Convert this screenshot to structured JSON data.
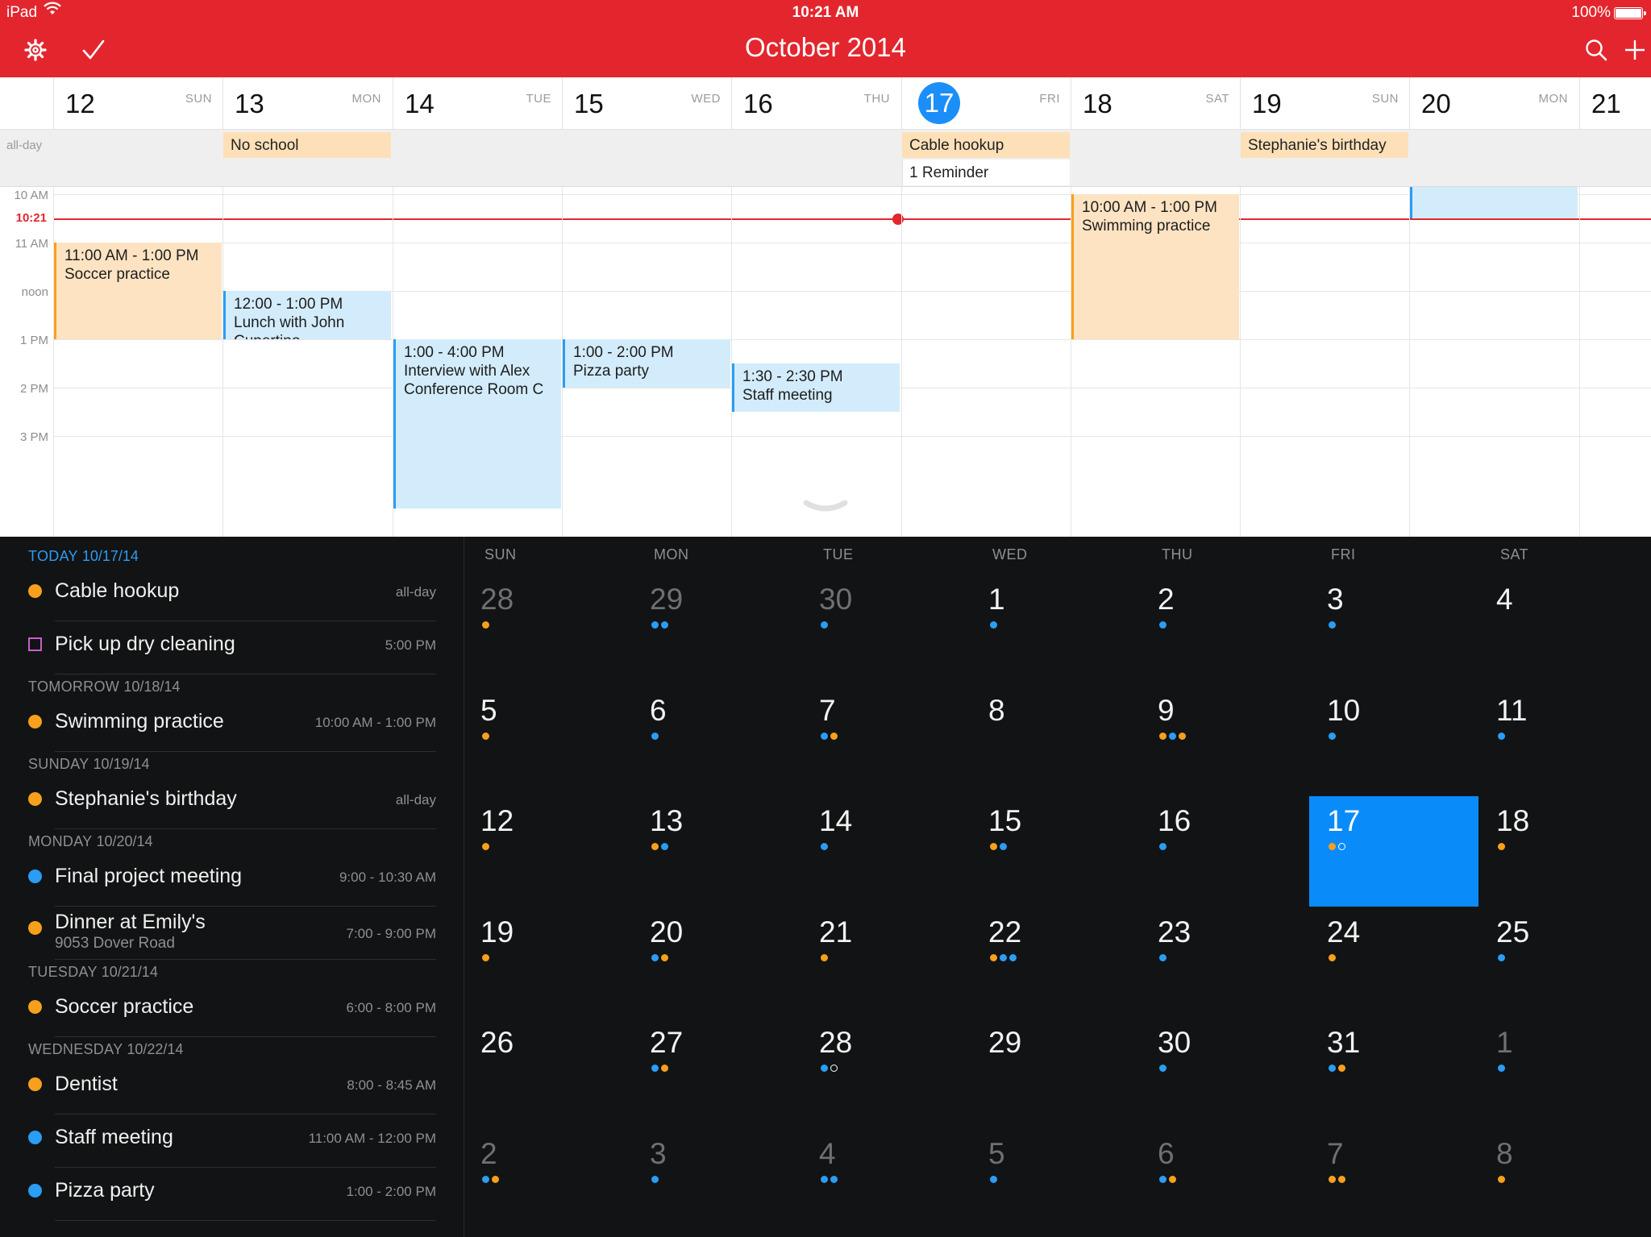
{
  "status": {
    "device": "iPad",
    "time": "10:21 AM",
    "battery": "100%"
  },
  "nav": {
    "title": "October 2014"
  },
  "colors": {
    "accent": "#e3262e",
    "today": "#1b8ef9",
    "orange": "#f7a01b",
    "blue": "#2a9df4"
  },
  "week": {
    "days": [
      {
        "num": "12",
        "wd": "SUN"
      },
      {
        "num": "13",
        "wd": "MON"
      },
      {
        "num": "14",
        "wd": "TUE"
      },
      {
        "num": "15",
        "wd": "WED"
      },
      {
        "num": "16",
        "wd": "THU"
      },
      {
        "num": "17",
        "wd": "FRI",
        "today": true
      },
      {
        "num": "18",
        "wd": "SAT"
      },
      {
        "num": "19",
        "wd": "SUN"
      },
      {
        "num": "20",
        "wd": "MON"
      },
      {
        "num": "21",
        "wd": ""
      }
    ],
    "allday_label": "all-day",
    "allday_events": [
      {
        "day": "13",
        "title": "No school"
      },
      {
        "day": "17",
        "title": "Cable hookup"
      },
      {
        "day": "19",
        "title": "Stephanie's birthday"
      }
    ],
    "reminder": {
      "day": "17",
      "text": "1 Reminder"
    },
    "hours": [
      "10 AM",
      "11 AM",
      "noon",
      "1 PM",
      "2 PM",
      "3 PM"
    ],
    "now_label": "10:21",
    "events": [
      {
        "day": "12",
        "color": "orange",
        "time": "11:00 AM - 1:00 PM",
        "title": "Soccer practice",
        "location": ""
      },
      {
        "day": "13",
        "color": "blue",
        "time": "12:00 - 1:00 PM",
        "title": "Lunch with John",
        "location": "Cupertino"
      },
      {
        "day": "14",
        "color": "blue",
        "time": "1:00 - 4:00 PM",
        "title": "Interview with Alex",
        "location": "Conference Room C"
      },
      {
        "day": "15",
        "color": "blue",
        "time": "1:00 - 2:00 PM",
        "title": "Pizza party",
        "location": ""
      },
      {
        "day": "16",
        "color": "blue",
        "time": "1:30 - 2:30 PM",
        "title": "Staff meeting",
        "location": ""
      },
      {
        "day": "18",
        "color": "orange",
        "time": "10:00 AM - 1:00 PM",
        "title": "Swimming practice",
        "location": ""
      },
      {
        "day": "20",
        "color": "blue",
        "time": "",
        "title": "",
        "location": ""
      }
    ]
  },
  "agenda": {
    "sections": [
      {
        "label": "TODAY",
        "date": "10/17/14",
        "today": true,
        "items": [
          {
            "kind": "dot",
            "color": "orange",
            "title": "Cable hookup",
            "time": "all-day"
          },
          {
            "kind": "box",
            "color": "purple",
            "title": "Pick up dry cleaning",
            "time": "5:00 PM"
          }
        ]
      },
      {
        "label": "TOMORROW",
        "date": "10/18/14",
        "items": [
          {
            "kind": "dot",
            "color": "orange",
            "title": "Swimming practice",
            "time": "10:00 AM - 1:00 PM"
          }
        ]
      },
      {
        "label": "SUNDAY",
        "date": "10/19/14",
        "items": [
          {
            "kind": "dot",
            "color": "orange",
            "title": "Stephanie's birthday",
            "time": "all-day"
          }
        ]
      },
      {
        "label": "MONDAY",
        "date": "10/20/14",
        "items": [
          {
            "kind": "dot",
            "color": "blue",
            "title": "Final project meeting",
            "time": "9:00 - 10:30 AM"
          },
          {
            "kind": "dot",
            "color": "orange",
            "title": "Dinner at Emily's",
            "sub": "9053 Dover Road",
            "time": "7:00 - 9:00 PM"
          }
        ]
      },
      {
        "label": "TUESDAY",
        "date": "10/21/14",
        "items": [
          {
            "kind": "dot",
            "color": "orange",
            "title": "Soccer practice",
            "time": "6:00 - 8:00 PM"
          }
        ]
      },
      {
        "label": "WEDNESDAY",
        "date": "10/22/14",
        "items": [
          {
            "kind": "dot",
            "color": "orange",
            "title": "Dentist",
            "time": "8:00 - 8:45 AM"
          },
          {
            "kind": "dot",
            "color": "blue",
            "title": "Staff meeting",
            "time": "11:00 AM - 12:00 PM"
          },
          {
            "kind": "dot",
            "color": "blue",
            "title": "Pizza party",
            "time": "1:00 - 2:00 PM"
          }
        ]
      }
    ]
  },
  "month": {
    "weekdays": [
      "SUN",
      "MON",
      "TUE",
      "WED",
      "THU",
      "FRI",
      "SAT"
    ],
    "weeks": [
      [
        {
          "d": "28",
          "o": true,
          "dots": "o"
        },
        {
          "d": "29",
          "o": true,
          "dots": "bb"
        },
        {
          "d": "30",
          "o": true,
          "dots": "b"
        },
        {
          "d": "1",
          "dots": "b"
        },
        {
          "d": "2",
          "dots": "b"
        },
        {
          "d": "3",
          "dots": "b"
        },
        {
          "d": "4",
          "dots": ""
        }
      ],
      [
        {
          "d": "5",
          "dots": "o"
        },
        {
          "d": "6",
          "dots": "b"
        },
        {
          "d": "7",
          "dots": "bo"
        },
        {
          "d": "8",
          "dots": ""
        },
        {
          "d": "9",
          "dots": "obo"
        },
        {
          "d": "10",
          "dots": "b"
        },
        {
          "d": "11",
          "dots": "b"
        }
      ],
      [
        {
          "d": "12",
          "dots": "o"
        },
        {
          "d": "13",
          "dots": "ob"
        },
        {
          "d": "14",
          "dots": "b"
        },
        {
          "d": "15",
          "dots": "ob"
        },
        {
          "d": "16",
          "dots": "b"
        },
        {
          "d": "17",
          "dots": "oc",
          "sel": true
        },
        {
          "d": "18",
          "dots": "o"
        }
      ],
      [
        {
          "d": "19",
          "dots": "o"
        },
        {
          "d": "20",
          "dots": "bo"
        },
        {
          "d": "21",
          "dots": "o"
        },
        {
          "d": "22",
          "dots": "obb"
        },
        {
          "d": "23",
          "dots": "b"
        },
        {
          "d": "24",
          "dots": "o"
        },
        {
          "d": "25",
          "dots": "b"
        }
      ],
      [
        {
          "d": "26",
          "dots": ""
        },
        {
          "d": "27",
          "dots": "bo"
        },
        {
          "d": "28",
          "dots": "bc"
        },
        {
          "d": "29",
          "dots": ""
        },
        {
          "d": "30",
          "dots": "b"
        },
        {
          "d": "31",
          "dots": "bo"
        },
        {
          "d": "1",
          "o": true,
          "dots": "b"
        }
      ],
      [
        {
          "d": "2",
          "o": true,
          "dots": "bo"
        },
        {
          "d": "3",
          "o": true,
          "dots": "b"
        },
        {
          "d": "4",
          "o": true,
          "dots": "bb"
        },
        {
          "d": "5",
          "o": true,
          "dots": "b"
        },
        {
          "d": "6",
          "o": true,
          "dots": "bo"
        },
        {
          "d": "7",
          "o": true,
          "dots": "oo"
        },
        {
          "d": "8",
          "o": true,
          "dots": "o"
        }
      ]
    ]
  }
}
